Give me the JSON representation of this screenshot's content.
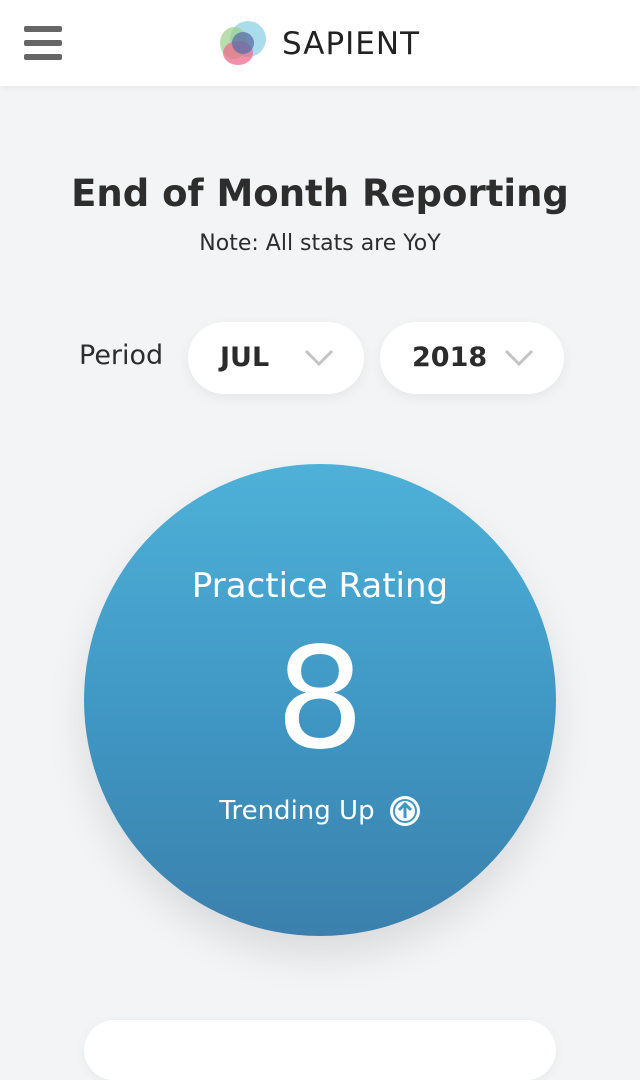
{
  "header": {
    "brand_name": "SAPIENT",
    "menu_icon": "hamburger-menu-icon",
    "logo": "sapient-logo"
  },
  "page": {
    "title": "End of Month Reporting",
    "note": "Note: All stats are YoY"
  },
  "period": {
    "label": "Period",
    "month": {
      "value": "JUL",
      "icon": "chevron-down-icon"
    },
    "year": {
      "value": "2018",
      "icon": "chevron-down-icon"
    }
  },
  "rating": {
    "title": "Practice Rating",
    "value": "8",
    "trend_label": "Trending Up",
    "trend_icon": "arrow-up-circle-icon"
  },
  "colors": {
    "background": "#f3f4f6",
    "card": "#ffffff",
    "circle_top": "#4eb1d8",
    "circle_bottom": "#3b80ad",
    "text_dark": "#2d2d2d"
  }
}
